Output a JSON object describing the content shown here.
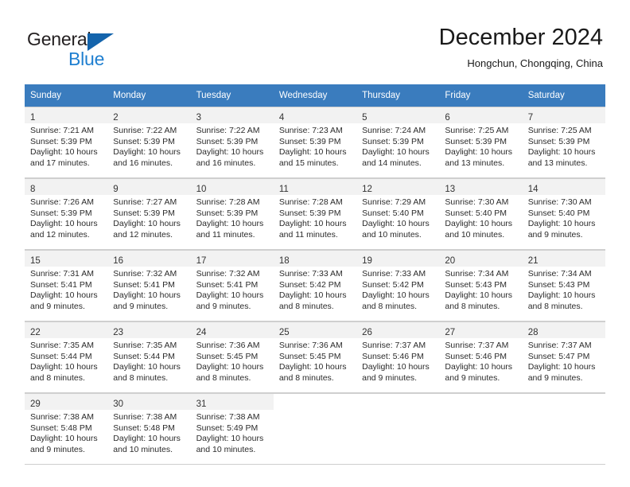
{
  "brand": {
    "name_top": "General",
    "name_bottom": "Blue",
    "triangle_color": "#1464ac",
    "blue_color": "#1f7fd0"
  },
  "header": {
    "title": "December 2024",
    "subtitle": "Hongchun, Chongqing, China"
  },
  "theme": {
    "header_row_background": "#3a7cbe",
    "header_row_text": "#ffffff",
    "daynum_strip_background": "#f2f2f2",
    "grid_line": "#cfcfcf",
    "body_text": "#2b2b2b"
  },
  "weekday_headers": [
    "Sunday",
    "Monday",
    "Tuesday",
    "Wednesday",
    "Thursday",
    "Friday",
    "Saturday"
  ],
  "labels": {
    "sunrise_prefix": "Sunrise:",
    "sunset_prefix": "Sunset:",
    "daylight_prefix": "Daylight:"
  },
  "weeks": [
    [
      {
        "day": "1",
        "sunrise": "Sunrise: 7:21 AM",
        "sunset": "Sunset: 5:39 PM",
        "daylight_line1": "Daylight: 10 hours",
        "daylight_line2": "and 17 minutes."
      },
      {
        "day": "2",
        "sunrise": "Sunrise: 7:22 AM",
        "sunset": "Sunset: 5:39 PM",
        "daylight_line1": "Daylight: 10 hours",
        "daylight_line2": "and 16 minutes."
      },
      {
        "day": "3",
        "sunrise": "Sunrise: 7:22 AM",
        "sunset": "Sunset: 5:39 PM",
        "daylight_line1": "Daylight: 10 hours",
        "daylight_line2": "and 16 minutes."
      },
      {
        "day": "4",
        "sunrise": "Sunrise: 7:23 AM",
        "sunset": "Sunset: 5:39 PM",
        "daylight_line1": "Daylight: 10 hours",
        "daylight_line2": "and 15 minutes."
      },
      {
        "day": "5",
        "sunrise": "Sunrise: 7:24 AM",
        "sunset": "Sunset: 5:39 PM",
        "daylight_line1": "Daylight: 10 hours",
        "daylight_line2": "and 14 minutes."
      },
      {
        "day": "6",
        "sunrise": "Sunrise: 7:25 AM",
        "sunset": "Sunset: 5:39 PM",
        "daylight_line1": "Daylight: 10 hours",
        "daylight_line2": "and 13 minutes."
      },
      {
        "day": "7",
        "sunrise": "Sunrise: 7:25 AM",
        "sunset": "Sunset: 5:39 PM",
        "daylight_line1": "Daylight: 10 hours",
        "daylight_line2": "and 13 minutes."
      }
    ],
    [
      {
        "day": "8",
        "sunrise": "Sunrise: 7:26 AM",
        "sunset": "Sunset: 5:39 PM",
        "daylight_line1": "Daylight: 10 hours",
        "daylight_line2": "and 12 minutes."
      },
      {
        "day": "9",
        "sunrise": "Sunrise: 7:27 AM",
        "sunset": "Sunset: 5:39 PM",
        "daylight_line1": "Daylight: 10 hours",
        "daylight_line2": "and 12 minutes."
      },
      {
        "day": "10",
        "sunrise": "Sunrise: 7:28 AM",
        "sunset": "Sunset: 5:39 PM",
        "daylight_line1": "Daylight: 10 hours",
        "daylight_line2": "and 11 minutes."
      },
      {
        "day": "11",
        "sunrise": "Sunrise: 7:28 AM",
        "sunset": "Sunset: 5:39 PM",
        "daylight_line1": "Daylight: 10 hours",
        "daylight_line2": "and 11 minutes."
      },
      {
        "day": "12",
        "sunrise": "Sunrise: 7:29 AM",
        "sunset": "Sunset: 5:40 PM",
        "daylight_line1": "Daylight: 10 hours",
        "daylight_line2": "and 10 minutes."
      },
      {
        "day": "13",
        "sunrise": "Sunrise: 7:30 AM",
        "sunset": "Sunset: 5:40 PM",
        "daylight_line1": "Daylight: 10 hours",
        "daylight_line2": "and 10 minutes."
      },
      {
        "day": "14",
        "sunrise": "Sunrise: 7:30 AM",
        "sunset": "Sunset: 5:40 PM",
        "daylight_line1": "Daylight: 10 hours",
        "daylight_line2": "and 9 minutes."
      }
    ],
    [
      {
        "day": "15",
        "sunrise": "Sunrise: 7:31 AM",
        "sunset": "Sunset: 5:41 PM",
        "daylight_line1": "Daylight: 10 hours",
        "daylight_line2": "and 9 minutes."
      },
      {
        "day": "16",
        "sunrise": "Sunrise: 7:32 AM",
        "sunset": "Sunset: 5:41 PM",
        "daylight_line1": "Daylight: 10 hours",
        "daylight_line2": "and 9 minutes."
      },
      {
        "day": "17",
        "sunrise": "Sunrise: 7:32 AM",
        "sunset": "Sunset: 5:41 PM",
        "daylight_line1": "Daylight: 10 hours",
        "daylight_line2": "and 9 minutes."
      },
      {
        "day": "18",
        "sunrise": "Sunrise: 7:33 AM",
        "sunset": "Sunset: 5:42 PM",
        "daylight_line1": "Daylight: 10 hours",
        "daylight_line2": "and 8 minutes."
      },
      {
        "day": "19",
        "sunrise": "Sunrise: 7:33 AM",
        "sunset": "Sunset: 5:42 PM",
        "daylight_line1": "Daylight: 10 hours",
        "daylight_line2": "and 8 minutes."
      },
      {
        "day": "20",
        "sunrise": "Sunrise: 7:34 AM",
        "sunset": "Sunset: 5:43 PM",
        "daylight_line1": "Daylight: 10 hours",
        "daylight_line2": "and 8 minutes."
      },
      {
        "day": "21",
        "sunrise": "Sunrise: 7:34 AM",
        "sunset": "Sunset: 5:43 PM",
        "daylight_line1": "Daylight: 10 hours",
        "daylight_line2": "and 8 minutes."
      }
    ],
    [
      {
        "day": "22",
        "sunrise": "Sunrise: 7:35 AM",
        "sunset": "Sunset: 5:44 PM",
        "daylight_line1": "Daylight: 10 hours",
        "daylight_line2": "and 8 minutes."
      },
      {
        "day": "23",
        "sunrise": "Sunrise: 7:35 AM",
        "sunset": "Sunset: 5:44 PM",
        "daylight_line1": "Daylight: 10 hours",
        "daylight_line2": "and 8 minutes."
      },
      {
        "day": "24",
        "sunrise": "Sunrise: 7:36 AM",
        "sunset": "Sunset: 5:45 PM",
        "daylight_line1": "Daylight: 10 hours",
        "daylight_line2": "and 8 minutes."
      },
      {
        "day": "25",
        "sunrise": "Sunrise: 7:36 AM",
        "sunset": "Sunset: 5:45 PM",
        "daylight_line1": "Daylight: 10 hours",
        "daylight_line2": "and 8 minutes."
      },
      {
        "day": "26",
        "sunrise": "Sunrise: 7:37 AM",
        "sunset": "Sunset: 5:46 PM",
        "daylight_line1": "Daylight: 10 hours",
        "daylight_line2": "and 9 minutes."
      },
      {
        "day": "27",
        "sunrise": "Sunrise: 7:37 AM",
        "sunset": "Sunset: 5:46 PM",
        "daylight_line1": "Daylight: 10 hours",
        "daylight_line2": "and 9 minutes."
      },
      {
        "day": "28",
        "sunrise": "Sunrise: 7:37 AM",
        "sunset": "Sunset: 5:47 PM",
        "daylight_line1": "Daylight: 10 hours",
        "daylight_line2": "and 9 minutes."
      }
    ],
    [
      {
        "day": "29",
        "sunrise": "Sunrise: 7:38 AM",
        "sunset": "Sunset: 5:48 PM",
        "daylight_line1": "Daylight: 10 hours",
        "daylight_line2": "and 9 minutes."
      },
      {
        "day": "30",
        "sunrise": "Sunrise: 7:38 AM",
        "sunset": "Sunset: 5:48 PM",
        "daylight_line1": "Daylight: 10 hours",
        "daylight_line2": "and 10 minutes."
      },
      {
        "day": "31",
        "sunrise": "Sunrise: 7:38 AM",
        "sunset": "Sunset: 5:49 PM",
        "daylight_line1": "Daylight: 10 hours",
        "daylight_line2": "and 10 minutes."
      },
      {
        "day": "",
        "sunrise": "",
        "sunset": "",
        "daylight_line1": "",
        "daylight_line2": ""
      },
      {
        "day": "",
        "sunrise": "",
        "sunset": "",
        "daylight_line1": "",
        "daylight_line2": ""
      },
      {
        "day": "",
        "sunrise": "",
        "sunset": "",
        "daylight_line1": "",
        "daylight_line2": ""
      },
      {
        "day": "",
        "sunrise": "",
        "sunset": "",
        "daylight_line1": "",
        "daylight_line2": ""
      }
    ]
  ]
}
